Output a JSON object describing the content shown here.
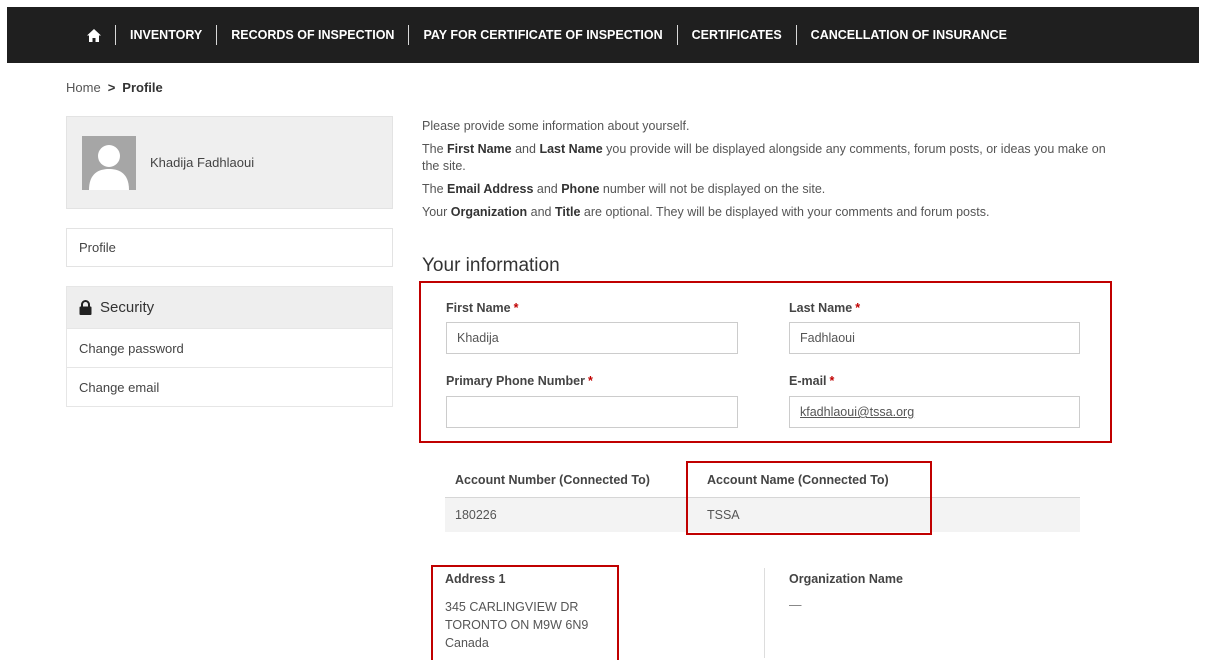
{
  "nav": {
    "home_icon": "home-icon",
    "items": [
      "INVENTORY",
      "RECORDS OF INSPECTION",
      "PAY FOR CERTIFICATE OF INSPECTION",
      "CERTIFICATES",
      "CANCELLATION OF INSURANCE"
    ]
  },
  "breadcrumb": {
    "home": "Home",
    "separator": ">",
    "current": "Profile"
  },
  "sidebar": {
    "user_name": "Khadija Fadhlaoui",
    "profile_link": "Profile",
    "security_heading": "Security",
    "security_icon": "lock-icon",
    "security_links": [
      "Change password",
      "Change email"
    ]
  },
  "intro": {
    "line1": "Please provide some information about yourself.",
    "line2_pre": "The ",
    "line2_b1": "First Name",
    "line2_mid": " and ",
    "line2_b2": "Last Name",
    "line2_post": " you provide will be displayed alongside any comments, forum posts, or ideas you make on the site.",
    "line3_pre": "The ",
    "line3_b1": "Email Address",
    "line3_mid": " and ",
    "line3_b2": "Phone",
    "line3_post": " number will not be displayed on the site.",
    "line4_pre": "Your ",
    "line4_b1": "Organization",
    "line4_mid": " and ",
    "line4_b2": "Title",
    "line4_post": " are optional. They will be displayed with your comments and forum posts."
  },
  "section_title": "Your information",
  "form": {
    "required_mark": "*",
    "first_name_label": "First Name",
    "first_name_value": "Khadija",
    "last_name_label": "Last Name",
    "last_name_value": "Fadhlaoui",
    "phone_label": "Primary Phone Number",
    "phone_value": "",
    "email_label": "E-mail",
    "email_value": "kfadhlaoui@tssa.org"
  },
  "account_table": {
    "headers": [
      "Account Number (Connected To)",
      "Account Name (Connected To)"
    ],
    "rows": [
      [
        "180226",
        "TSSA"
      ]
    ]
  },
  "address": {
    "label": "Address 1",
    "lines": [
      "345 CARLINGVIEW DR",
      "TORONTO ON M9W 6N9",
      "Canada"
    ]
  },
  "organization": {
    "label": "Organization Name",
    "value": "—"
  },
  "colors": {
    "nav_bg": "#1f1f1f",
    "highlight": "#c00000",
    "required": "#c00000"
  }
}
